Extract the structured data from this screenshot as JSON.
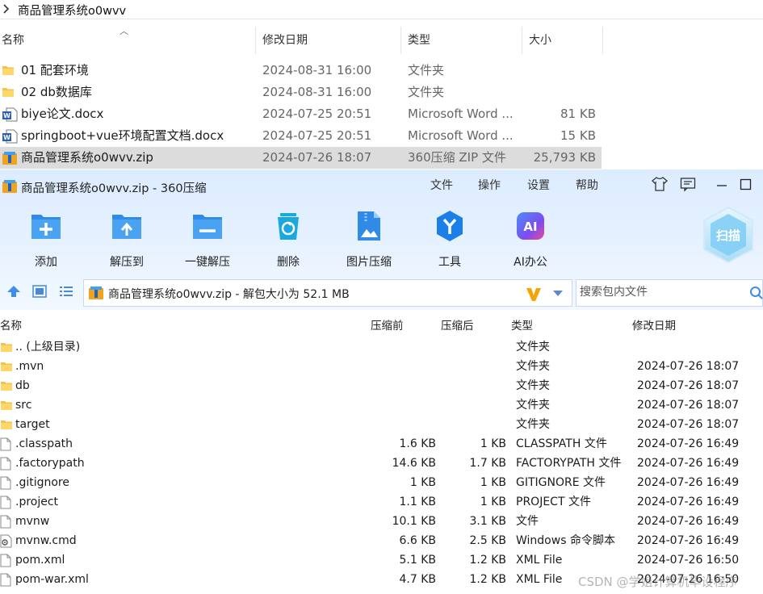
{
  "explorer": {
    "breadcrumb": "商品管理系统o0wvv",
    "columns": {
      "name": "名称",
      "date": "修改日期",
      "type": "类型",
      "size": "大小"
    },
    "files": [
      {
        "name": "01 配套环境",
        "date": "2024-08-31 16:00",
        "type": "文件夹",
        "size": "",
        "icon": "folder-icon"
      },
      {
        "name": "02 db数据库",
        "date": "2024-08-31 16:00",
        "type": "文件夹",
        "size": "",
        "icon": "folder-icon"
      },
      {
        "name": "biye论文.docx",
        "date": "2024-07-25 20:51",
        "type": "Microsoft Word ...",
        "size": "81 KB",
        "icon": "word-doc-icon"
      },
      {
        "name": "springboot+vue环境配置文档.docx",
        "date": "2024-07-25 20:51",
        "type": "Microsoft Word ...",
        "size": "15 KB",
        "icon": "word-doc-icon"
      },
      {
        "name": "商品管理系统o0wvv.zip",
        "date": "2024-07-26 18:07",
        "type": "360压缩 ZIP 文件",
        "size": "25,793 KB",
        "icon": "zip-archive-icon",
        "selected": true
      }
    ]
  },
  "zipwin": {
    "title": "商品管理系统o0wvv.zip - 360压缩",
    "menu": [
      "文件",
      "操作",
      "设置",
      "帮助"
    ],
    "toolbar": [
      {
        "label": "添加",
        "icon": "add-icon",
        "color": "#2f8ae8"
      },
      {
        "label": "解压到",
        "icon": "extract-to-icon",
        "color": "#2f8ae8"
      },
      {
        "label": "一键解压",
        "icon": "one-click-extract-icon",
        "color": "#2f8ae8"
      },
      {
        "label": "删除",
        "icon": "delete-icon",
        "color": "#1aa8e0"
      },
      {
        "label": "图片压缩",
        "icon": "image-compress-icon",
        "color": "#2f8ae8"
      },
      {
        "label": "工具",
        "icon": "tools-icon",
        "color": "#1a7fe8"
      },
      {
        "label": "AI办公",
        "icon": "ai-office-icon",
        "color": "#7b4df0"
      }
    ],
    "scan_label": "扫描",
    "address": "商品管理系统o0wvv.zip - 解包大小为 52.1 MB",
    "search_placeholder": "搜索包内文件",
    "columns": {
      "name": "名称",
      "before": "压缩前",
      "after": "压缩后",
      "type": "类型",
      "date": "修改日期"
    },
    "entries": [
      {
        "name": ".. (上级目录)",
        "before": "",
        "after": "",
        "type": "文件夹",
        "date": "",
        "icon": "folder-icon"
      },
      {
        "name": ".mvn",
        "before": "",
        "after": "",
        "type": "文件夹",
        "date": "2024-07-26 18:07",
        "icon": "folder-icon"
      },
      {
        "name": "db",
        "before": "",
        "after": "",
        "type": "文件夹",
        "date": "2024-07-26 18:07",
        "icon": "folder-icon"
      },
      {
        "name": "src",
        "before": "",
        "after": "",
        "type": "文件夹",
        "date": "2024-07-26 18:07",
        "icon": "folder-icon"
      },
      {
        "name": "target",
        "before": "",
        "after": "",
        "type": "文件夹",
        "date": "2024-07-26 18:07",
        "icon": "folder-icon"
      },
      {
        "name": ".classpath",
        "before": "1.6 KB",
        "after": "1 KB",
        "type": "CLASSPATH 文件",
        "date": "2024-07-26 16:49",
        "icon": "file-icon"
      },
      {
        "name": ".factorypath",
        "before": "14.6 KB",
        "after": "1.7 KB",
        "type": "FACTORYPATH 文件",
        "date": "2024-07-26 16:49",
        "icon": "file-icon"
      },
      {
        "name": ".gitignore",
        "before": "1 KB",
        "after": "1 KB",
        "type": "GITIGNORE 文件",
        "date": "2024-07-26 16:49",
        "icon": "file-icon"
      },
      {
        "name": ".project",
        "before": "1.1 KB",
        "after": "1 KB",
        "type": "PROJECT 文件",
        "date": "2024-07-26 16:49",
        "icon": "file-icon"
      },
      {
        "name": "mvnw",
        "before": "10.1 KB",
        "after": "3.1 KB",
        "type": "文件",
        "date": "2024-07-26 16:49",
        "icon": "file-icon"
      },
      {
        "name": "mvnw.cmd",
        "before": "6.6 KB",
        "after": "2.5 KB",
        "type": "Windows 命令脚本",
        "date": "2024-07-26 16:49",
        "icon": "script-file-icon"
      },
      {
        "name": "pom.xml",
        "before": "5.1 KB",
        "after": "1.2 KB",
        "type": "XML File",
        "date": "2024-07-26 16:50",
        "icon": "file-icon"
      },
      {
        "name": "pom-war.xml",
        "before": "4.7 KB",
        "after": "1.2 KB",
        "type": "XML File",
        "date": "2024-07-26 16:50",
        "icon": "file-icon"
      }
    ]
  },
  "watermark": "CSDN @学姐计算机毕设程序"
}
